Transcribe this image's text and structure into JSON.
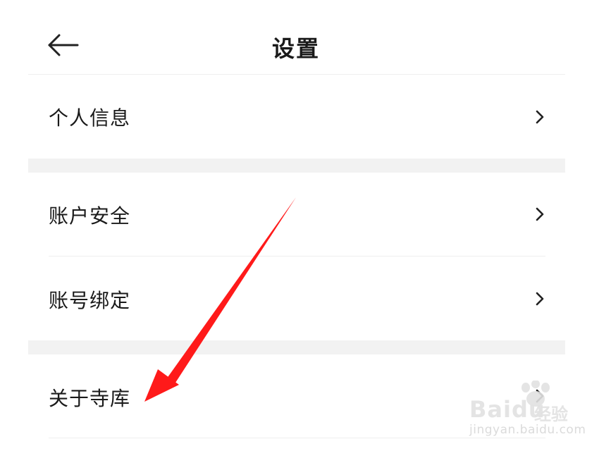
{
  "header": {
    "title": "设置",
    "back_icon": "arrow-left-icon"
  },
  "sections": [
    {
      "items": [
        {
          "label": "个人信息",
          "icon": "chevron-right-icon"
        }
      ]
    },
    {
      "items": [
        {
          "label": "账户安全",
          "icon": "chevron-right-icon"
        },
        {
          "label": "账号绑定",
          "icon": "chevron-right-icon"
        }
      ]
    },
    {
      "items": [
        {
          "label": "关于寺库",
          "icon": "chevron-right-icon"
        }
      ]
    }
  ],
  "annotation": {
    "color": "#ff1a1a",
    "target": "关于寺库"
  },
  "watermark": {
    "brand": "Baidu",
    "sub": "经验",
    "url": "jingyan.baidu.com"
  },
  "colors": {
    "background": "#ffffff",
    "section_gap": "#f2f2f2",
    "divider": "#efefef",
    "text": "#1a1a1a"
  }
}
